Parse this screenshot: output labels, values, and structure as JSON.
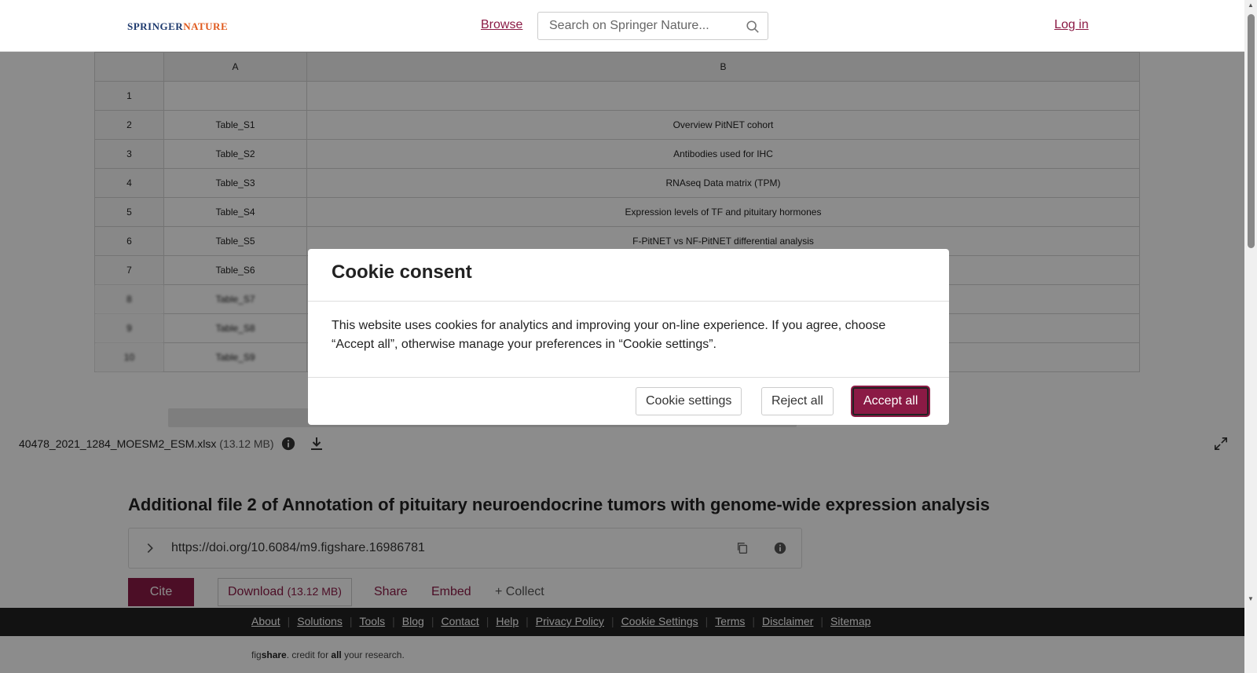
{
  "header": {
    "logo_part1": "SPRINGER",
    "logo_part2": "NATURE",
    "browse": "Browse",
    "search_placeholder": "Search on Springer Nature...",
    "login": "Log in"
  },
  "sheet": {
    "columns": [
      "A",
      "B"
    ],
    "rows": [
      {
        "n": "1",
        "a": "",
        "b": ""
      },
      {
        "n": "2",
        "a": "Table_S1",
        "b": "Overview PitNET cohort"
      },
      {
        "n": "3",
        "a": "Table_S2",
        "b": "Antibodies used for IHC"
      },
      {
        "n": "4",
        "a": "Table_S3",
        "b": "RNAseq Data matrix (TPM)"
      },
      {
        "n": "5",
        "a": "Table_S4",
        "b": "Expression levels of TF and pituitary hormones"
      },
      {
        "n": "6",
        "a": "Table_S5",
        "b": "F-PitNET vs NF-PitNET differential analysis"
      },
      {
        "n": "7",
        "a": "Table_S6",
        "b": ""
      },
      {
        "n": "8",
        "a": "Table_S7",
        "b": ""
      },
      {
        "n": "9",
        "a": "Table_S8",
        "b": ""
      },
      {
        "n": "10",
        "a": "Table_S9",
        "b": ""
      }
    ]
  },
  "filebar": {
    "filename": "40478_2021_1284_MOESM2_ESM.xlsx",
    "size": "(13.12 MB)"
  },
  "main": {
    "title": "Additional file 2 of Annotation of pituitary neuroendocrine tumors with genome-wide expression analysis",
    "doi": "https://doi.org/10.6084/m9.figshare.16986781",
    "cite": "Cite",
    "download": "Download",
    "download_size": "(13.12 MB)",
    "share": "Share",
    "embed": "Embed",
    "collect": "+ Collect"
  },
  "footer": {
    "links": [
      "About",
      "Solutions",
      "Tools",
      "Blog",
      "Contact",
      "Help",
      "Privacy Policy",
      "Cookie Settings",
      "Terms",
      "Disclaimer",
      "Sitemap"
    ],
    "tagline_fig": "fig",
    "tagline_share": "share",
    "tagline_mid": ". credit for ",
    "tagline_all": "all",
    "tagline_end": " your research."
  },
  "modal": {
    "title": "Cookie consent",
    "body": "This website uses cookies for analytics and improving your on-line experience. If you agree, choose “Accept all”, otherwise manage your preferences in “Cookie settings”.",
    "settings": "Cookie settings",
    "reject": "Reject all",
    "accept": "Accept all"
  },
  "colors": {
    "accent": "#8b1a45",
    "footer_bg": "#222222"
  }
}
